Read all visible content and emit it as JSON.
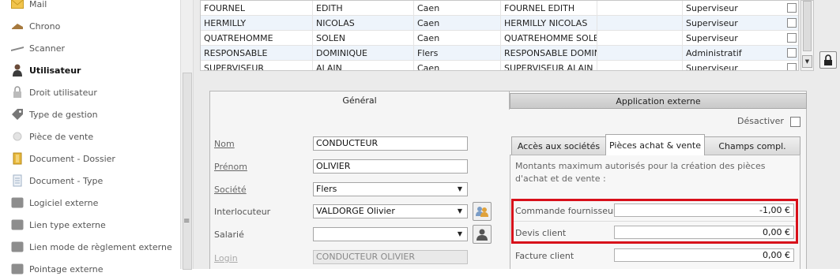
{
  "sidebar": {
    "items": [
      {
        "label": "Mail",
        "icon": "mail-icon"
      },
      {
        "label": "Chrono",
        "icon": "chrono-icon"
      },
      {
        "label": "Scanner",
        "icon": "scanner-icon"
      },
      {
        "label": "Utilisateur",
        "icon": "user-icon",
        "active": true
      },
      {
        "label": "Droit utilisateur",
        "icon": "lock-icon"
      },
      {
        "label": "Type de gestion",
        "icon": "tag-icon"
      },
      {
        "label": "Pièce de vente",
        "icon": "sale-doc-icon"
      },
      {
        "label": "Document - Dossier",
        "icon": "folder-icon"
      },
      {
        "label": "Document - Type",
        "icon": "document-icon"
      },
      {
        "label": "Logiciel externe",
        "icon": "app-icon"
      },
      {
        "label": "Lien type externe",
        "icon": "link-icon"
      },
      {
        "label": "Lien mode de règlement externe",
        "icon": "link-icon"
      },
      {
        "label": "Pointage externe",
        "icon": "clock-icon"
      }
    ]
  },
  "grid": {
    "rows": [
      {
        "nom": "FOURNEL",
        "prenom": "EDITH",
        "societe": "Caen",
        "complet": "FOURNEL EDITH",
        "profil": "Superviseur"
      },
      {
        "nom": "HERMILLY",
        "prenom": "NICOLAS",
        "societe": "Caen",
        "complet": "HERMILLY NICOLAS",
        "profil": "Superviseur"
      },
      {
        "nom": "QUATREHOMME",
        "prenom": "SOLEN",
        "societe": "Caen",
        "complet": "QUATREHOMME SOLEN",
        "profil": "Superviseur"
      },
      {
        "nom": "RESPONSABLE",
        "prenom": "DOMINIQUE",
        "societe": "Flers",
        "complet": "RESPONSABLE DOMIN...",
        "profil": "Administratif"
      },
      {
        "nom": "SUPERVISEUR",
        "prenom": "ALAIN",
        "societe": "Caen",
        "complet": "SUPERVISEUR ALAIN",
        "profil": "Superviseur"
      }
    ]
  },
  "tabs": {
    "general": "Général",
    "application_externe": "Application externe"
  },
  "desactiver_label": "Désactiver",
  "form": {
    "nom": {
      "label": "Nom",
      "value": "CONDUCTEUR"
    },
    "prenom": {
      "label": "Prénom",
      "value": "OLIVIER"
    },
    "societe": {
      "label": "Société",
      "value": "Flers"
    },
    "interlocuteur": {
      "label": "Interlocuteur",
      "value": "VALDORGE Olivier"
    },
    "salarie": {
      "label": "Salarié",
      "value": ""
    },
    "login": {
      "label": "Login",
      "value": "CONDUCTEUR OLIVIER"
    }
  },
  "subtabs": {
    "acces": "Accès aux sociétés",
    "pieces": "Pièces achat & vente",
    "champs": "Champs compl."
  },
  "montants": {
    "description": "Montants maximum autorisés pour la création des pièces d'achat et de vente :",
    "commande_fournisseur": {
      "label": "Commande fournisseur",
      "value": "-1,00 €"
    },
    "devis_client": {
      "label": "Devis client",
      "value": "0,00 €"
    },
    "facture_client": {
      "label": "Facture client",
      "value": "0,00 €"
    }
  },
  "colors": {
    "highlight": "#d8101a",
    "grid_alt_row": "#eef4fb"
  }
}
